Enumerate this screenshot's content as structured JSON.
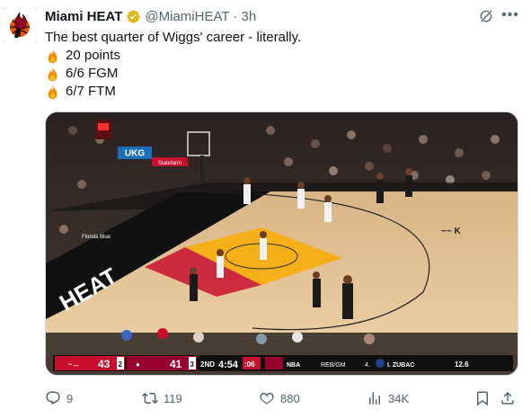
{
  "header": {
    "display_name": "Miami HEAT",
    "handle": "@MiamiHEAT",
    "separator": "·",
    "time": "3h"
  },
  "tweet": {
    "text": "The best quarter of Wiggs' career - literally.",
    "stats": [
      {
        "icon": "fire-emoji",
        "label": "20 points"
      },
      {
        "icon": "fire-emoji",
        "label": "6/6 FGM"
      },
      {
        "icon": "fire-emoji",
        "label": "6/7 FTM"
      }
    ]
  },
  "media": {
    "scorebug": {
      "away_score": "43",
      "away_timeouts": "2",
      "home_score": "41",
      "home_timeouts": "3",
      "quarter": "2ND",
      "clock": "4:54",
      "shot_clock": ":06",
      "league": "NBA",
      "stat_label": "REB/GM",
      "player_number": "4.",
      "player_name": "I. ZUBAC",
      "stat_value": "12.6"
    },
    "court_signage": {
      "sponsor_1": "UKG",
      "sponsor_2": "Statefarm",
      "sponsor_3": "Florida Blue",
      "sideline_text": "HEAT"
    },
    "colors": {
      "heat_red": "#98002e",
      "clippers_red": "#c8102e",
      "court_wood": "#e8c595",
      "paint": "#f5b019"
    }
  },
  "actions": {
    "reply_count": "9",
    "retweet_count": "119",
    "like_count": "880",
    "views_count": "34K"
  }
}
